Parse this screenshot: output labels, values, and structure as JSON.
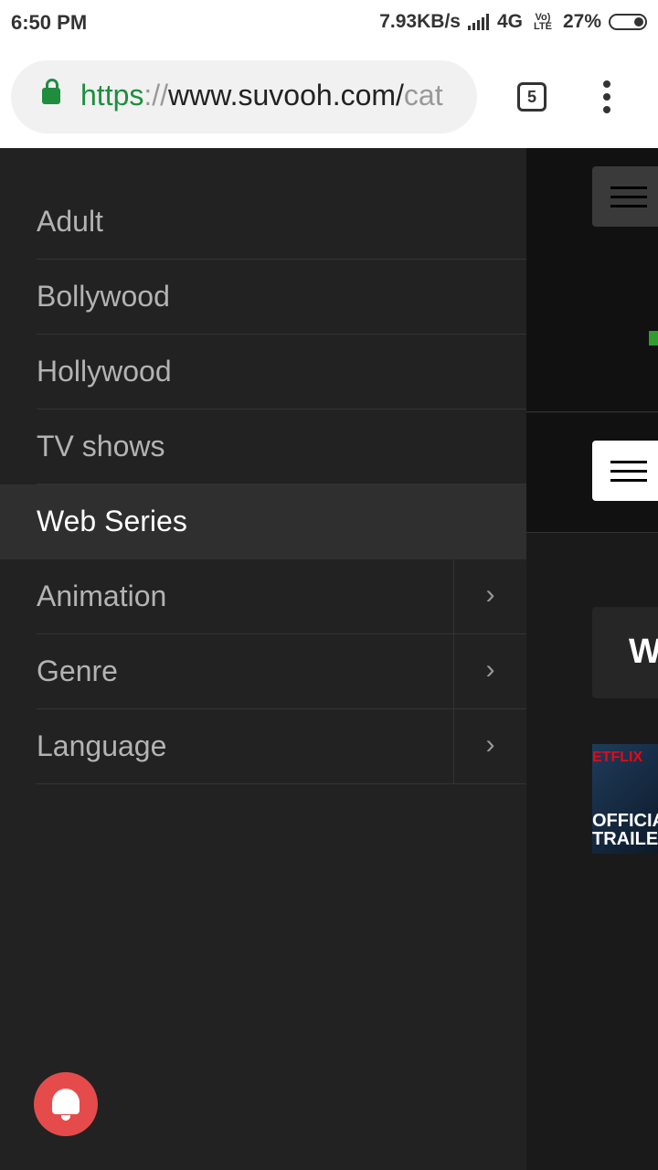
{
  "status_bar": {
    "time": "6:50 PM",
    "speed": "7.93KB/s",
    "network": "4G",
    "volte": "Vo) LTE",
    "battery": "27%"
  },
  "browser": {
    "url_scheme": "https",
    "url_sep": "://",
    "url_host": "www.suvooh.com/",
    "url_rest": "cat",
    "tab_count": "5"
  },
  "drawer": {
    "items": [
      {
        "label": "Adult",
        "active": false,
        "has_submenu": false
      },
      {
        "label": "Bollywood",
        "active": false,
        "has_submenu": false
      },
      {
        "label": "Hollywood",
        "active": false,
        "has_submenu": false
      },
      {
        "label": "TV shows",
        "active": false,
        "has_submenu": false
      },
      {
        "label": "Web Series",
        "active": true,
        "has_submenu": false
      },
      {
        "label": "Animation",
        "active": false,
        "has_submenu": true
      },
      {
        "label": "Genre",
        "active": false,
        "has_submenu": true
      },
      {
        "label": "Language",
        "active": false,
        "has_submenu": true
      }
    ],
    "chevron_glyph": "›"
  },
  "page": {
    "card_letter": "W",
    "thumb_brand": "ETFLIX",
    "thumb_line1": "OFFICIA",
    "thumb_line2": "TRAILE"
  },
  "colors": {
    "accent_green": "#1e8e3e",
    "bell_red": "#e54b4b",
    "drawer_bg": "#222222",
    "active_bg": "#2f2f2f"
  },
  "icons": [
    "lock-icon",
    "tab-switcher-icon",
    "overflow-menu-icon",
    "chevron-right-icon",
    "notification-bell-icon",
    "hamburger-icon"
  ]
}
